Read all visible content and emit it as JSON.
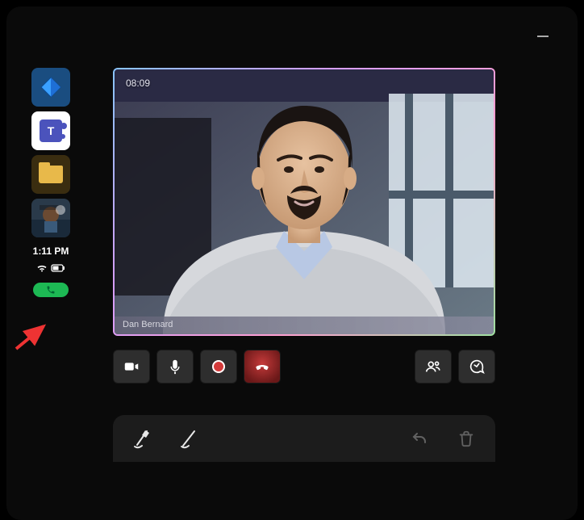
{
  "window": {
    "minimize_icon": "minimize-icon"
  },
  "sidebar": {
    "apps": [
      {
        "name": "dynamics",
        "icon": "diamond-icon"
      },
      {
        "name": "teams",
        "icon": "teams-icon",
        "label": "T",
        "active": true
      },
      {
        "name": "files",
        "icon": "folder-icon"
      },
      {
        "name": "user-avatar",
        "icon": "avatar-icon"
      }
    ],
    "time": "1:11 PM",
    "status": {
      "wifi": "wifi-icon",
      "battery": "battery-icon"
    },
    "call_indicator": {
      "icon": "phone-icon",
      "color": "#1db954"
    }
  },
  "call": {
    "timer": "08:09",
    "participant_name": "Dan Bernard",
    "controls": {
      "camera": "camera-icon",
      "mic": "mic-icon",
      "record": "record-icon",
      "hangup": "hangup-icon",
      "people": "people-icon",
      "chat": "chat-icon"
    }
  },
  "tray": {
    "pen1": "pen-highlighter-icon",
    "pen2": "pen-thin-icon",
    "undo": "undo-icon",
    "delete": "trash-icon"
  },
  "annotation": {
    "arrow_target": "call-indicator"
  }
}
